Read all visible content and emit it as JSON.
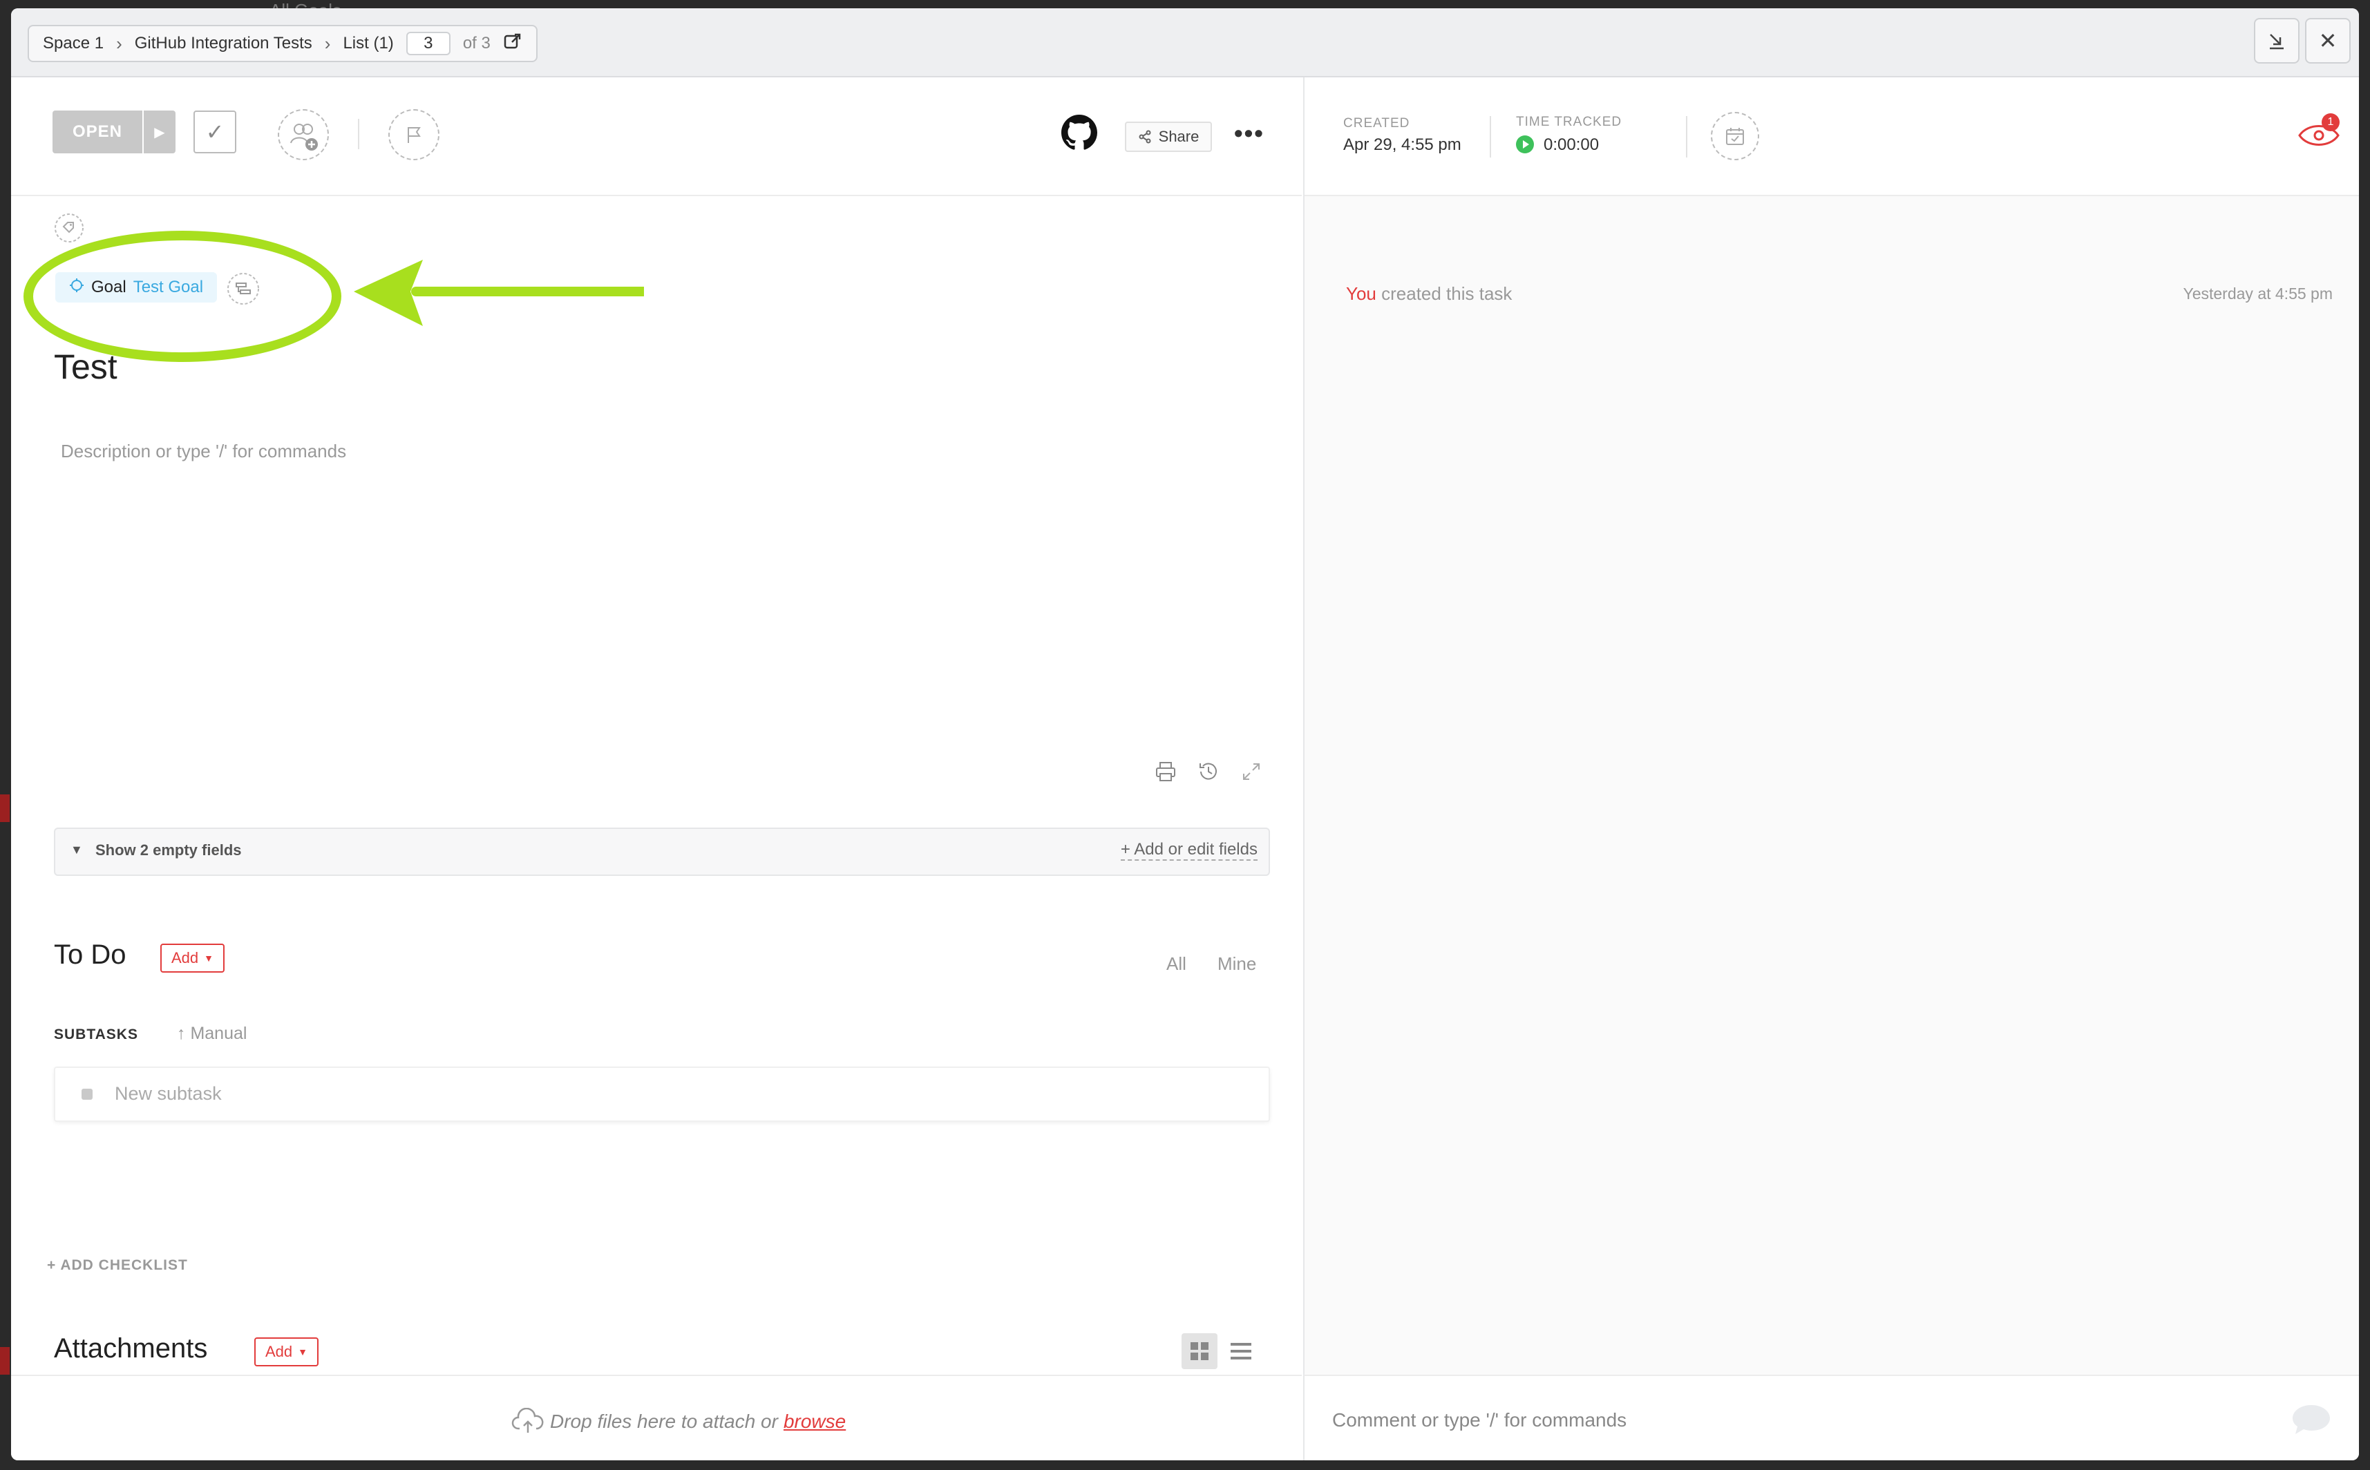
{
  "background": {
    "behind_text": "All Goals"
  },
  "breadcrumb": {
    "items": [
      "Space 1",
      "GitHub Integration Tests",
      "List (1)"
    ],
    "page_current": "3",
    "page_total": "of 3"
  },
  "task": {
    "status": "OPEN",
    "goal_label": "Goal",
    "goal_value": "Test Goal",
    "title": "Test",
    "description_placeholder": "Description or type '/' for commands",
    "share_label": "Share"
  },
  "fields": {
    "show_empty": "Show 2 empty fields",
    "add_edit": "+ Add or edit fields"
  },
  "todo": {
    "title": "To Do",
    "add_label": "Add",
    "filter_all": "All",
    "filter_mine": "Mine",
    "subtasks_label": "SUBTASKS",
    "sort_label": "Manual",
    "new_subtask_placeholder": "New subtask",
    "add_checklist": "+ ADD CHECKLIST"
  },
  "attachments": {
    "title": "Attachments",
    "add_label": "Add",
    "drop_text": "Drop files here to attach or",
    "browse_label": "browse"
  },
  "meta": {
    "created_label": "CREATED",
    "created_value": "Apr 29, 4:55 pm",
    "time_tracked_label": "TIME TRACKED",
    "time_tracked_value": "0:00:00",
    "watchers_count": "1"
  },
  "activity": {
    "actor": "You",
    "text": "created this task",
    "time": "Yesterday at 4:55 pm"
  },
  "comment": {
    "placeholder": "Comment or type '/' for commands"
  },
  "colors": {
    "accent_red": "#e23c3c",
    "goal_blue": "#3aa9e0",
    "annotation_green": "#a8df1e",
    "timer_green": "#3ec15b"
  }
}
